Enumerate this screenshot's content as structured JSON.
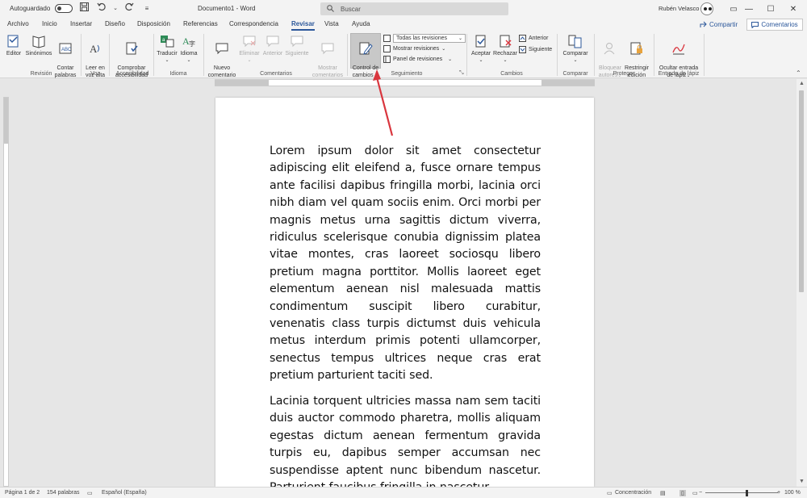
{
  "titlebar": {
    "autosave_label": "Autoguardado",
    "doc_title": "Documento1 - Word",
    "search_placeholder": "Buscar",
    "user_name": "Rubén Velasco",
    "minimize": "—",
    "maximize": "☐",
    "close": "✕",
    "ribbon_opts": "▭"
  },
  "tabs": [
    "Archivo",
    "Inicio",
    "Insertar",
    "Diseño",
    "Disposición",
    "Referencias",
    "Correspondencia",
    "Revisar",
    "Vista",
    "Ayuda"
  ],
  "active_tab": "Revisar",
  "share_label": "Compartir",
  "comments_label": "Comentarios",
  "ribbon": {
    "editor": "Editor",
    "sinonimos": "Sinónimos",
    "contar": "Contar\npalabras",
    "leer": "Leer en\nvoz alta",
    "comprobar": "Comprobar\naccesibilidad",
    "traducir": "Traducir",
    "idioma": "Idioma",
    "nuevo_comentario": "Nuevo\ncomentario",
    "eliminar": "Eliminar",
    "anterior_c": "Anterior",
    "siguiente_c": "Siguiente",
    "mostrar_comentarios": "Mostrar\ncomentarios",
    "control_cambios": "Control de\ncambios",
    "todas_revisiones": "Todas las revisiones",
    "mostrar_revisiones": "Mostrar revisiones",
    "panel_revisiones": "Panel de revisiones",
    "aceptar": "Aceptar",
    "rechazar": "Rechazar",
    "anterior": "Anterior",
    "siguiente": "Siguiente",
    "comparar": "Comparar",
    "bloquear": "Bloquear\nautores",
    "restringir": "Restringir\nedición",
    "ocultar": "Ocultar entrada\nde lápiz",
    "groups": {
      "revision": "Revisión",
      "voz": "Voz",
      "accesibilidad": "Accesibilidad",
      "idioma": "Idioma",
      "comentarios": "Comentarios",
      "seguimiento": "Seguimiento",
      "cambios": "Cambios",
      "comparar": "Comparar",
      "proteger": "Proteger",
      "entrada_lapiz": "Entrada de lápiz"
    }
  },
  "document": {
    "paragraphs": [
      "Lorem ipsum dolor sit amet consectetur adipiscing elit eleifend a, fusce ornare tempus ante facilisi dapibus fringilla morbi, lacinia orci nibh diam vel quam sociis enim. Orci morbi per magnis metus urna sagittis dictum viverra, ridiculus scelerisque conubia dignissim platea vitae montes, cras laoreet sociosqu libero pretium magna porttitor. Mollis laoreet eget elementum aenean nisl malesuada mattis condimentum suscipit libero curabitur, venenatis class turpis dictumst duis vehicula metus interdum primis potenti ullamcorper, senectus tempus ultrices neque cras erat pretium parturient taciti sed.",
      "Lacinia torquent ultricies massa nam sem taciti duis auctor commodo pharetra, mollis aliquam egestas dictum aenean fermentum gravida turpis eu, dapibus semper accumsan nec suspendisse aptent nunc bibendum nascetur. Parturient faucibus fringilla in nascetur"
    ]
  },
  "statusbar": {
    "page": "Página 1 de 2",
    "words": "154 palabras",
    "language": "Español (España)",
    "focus": "Concentración",
    "zoom": "100 %"
  },
  "colors": {
    "accent": "#2b579a",
    "annotation_arrow": "#d9363e"
  }
}
